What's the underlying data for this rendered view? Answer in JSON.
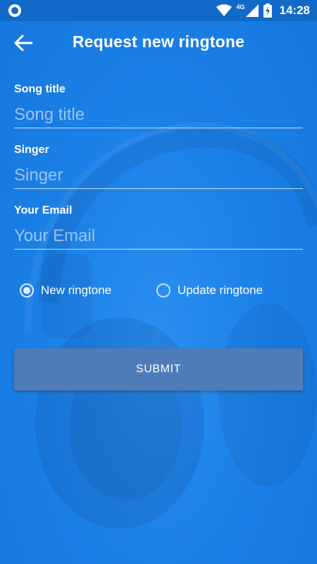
{
  "status_bar": {
    "time": "14:28",
    "network_type": "4G"
  },
  "app_bar": {
    "title": "Request new ringtone"
  },
  "form": {
    "fields": [
      {
        "label": "Song title",
        "placeholder": "Song title",
        "value": ""
      },
      {
        "label": "Singer",
        "placeholder": "Singer",
        "value": ""
      },
      {
        "label": "Your Email",
        "placeholder": "Your Email",
        "value": ""
      }
    ],
    "options": [
      {
        "label": "New ringtone",
        "selected": true
      },
      {
        "label": "Update ringtone",
        "selected": false
      }
    ],
    "submit_label": "SUBMIT"
  },
  "colors": {
    "background": "#1b84ea",
    "status_bar": "#1169c8",
    "button": "#4f7bb8"
  }
}
